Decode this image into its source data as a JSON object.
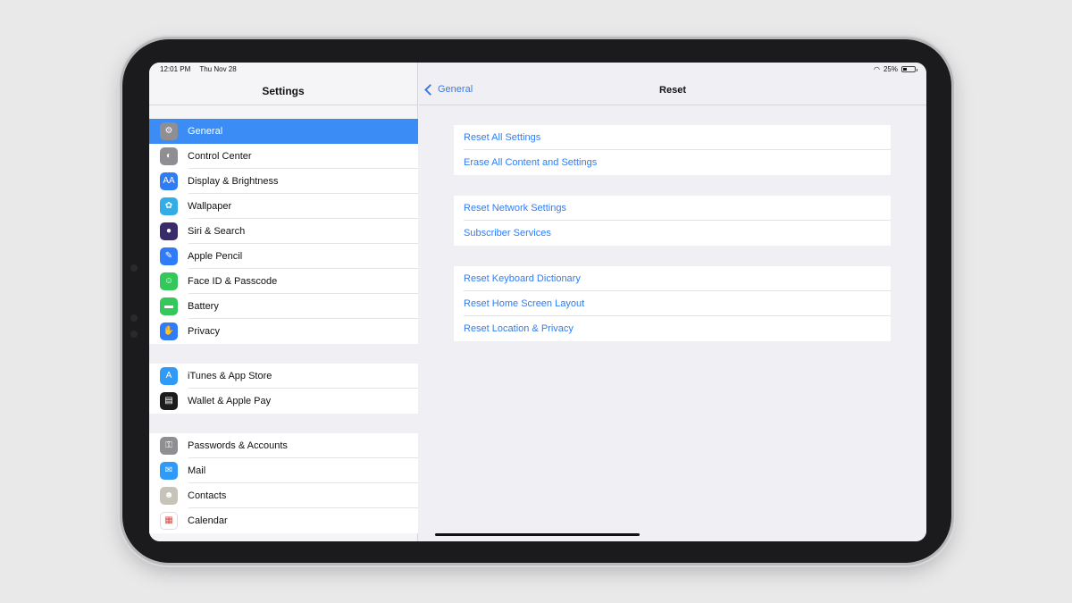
{
  "status": {
    "time": "12:01 PM",
    "date": "Thu Nov 28",
    "battery": "25%"
  },
  "sidebar": {
    "title": "Settings",
    "groups": [
      [
        {
          "label": "General",
          "icon": "gear-icon",
          "color": "#8e8e93",
          "glyph": "⚙",
          "selected": true
        },
        {
          "label": "Control Center",
          "icon": "toggles-icon",
          "color": "#8e8e93",
          "glyph": "◐"
        },
        {
          "label": "Display & Brightness",
          "icon": "text-size-icon",
          "color": "#2f7cf6",
          "glyph": "AA"
        },
        {
          "label": "Wallpaper",
          "icon": "flower-icon",
          "color": "#32ade6",
          "glyph": "✿"
        },
        {
          "label": "Siri & Search",
          "icon": "siri-icon",
          "color": "#3a2c68",
          "glyph": "●"
        },
        {
          "label": "Apple Pencil",
          "icon": "pencil-icon",
          "color": "#2f7cf6",
          "glyph": "✎"
        },
        {
          "label": "Face ID & Passcode",
          "icon": "face-id-icon",
          "color": "#34c759",
          "glyph": "☺"
        },
        {
          "label": "Battery",
          "icon": "battery-icon",
          "color": "#34c759",
          "glyph": "▬"
        },
        {
          "label": "Privacy",
          "icon": "hand-icon",
          "color": "#2f7cf6",
          "glyph": "✋"
        }
      ],
      [
        {
          "label": "iTunes & App Store",
          "icon": "app-store-icon",
          "color": "#2f9bf6",
          "glyph": "A"
        },
        {
          "label": "Wallet & Apple Pay",
          "icon": "wallet-icon",
          "color": "#1c1c1e",
          "glyph": "▤"
        }
      ],
      [
        {
          "label": "Passwords & Accounts",
          "icon": "key-icon",
          "color": "#8e8e93",
          "glyph": "⚿"
        },
        {
          "label": "Mail",
          "icon": "mail-icon",
          "color": "#2f9bf6",
          "glyph": "✉"
        },
        {
          "label": "Contacts",
          "icon": "contacts-icon",
          "color": "#c7c3b8",
          "glyph": "☻"
        },
        {
          "label": "Calendar",
          "icon": "calendar-icon",
          "color": "#ffffff",
          "glyph": "▦"
        }
      ]
    ]
  },
  "detail": {
    "back_label": "General",
    "title": "Reset",
    "groups": [
      [
        "Reset All Settings",
        "Erase All Content and Settings"
      ],
      [
        "Reset Network Settings",
        "Subscriber Services"
      ],
      [
        "Reset Keyboard Dictionary",
        "Reset Home Screen Layout",
        "Reset Location & Privacy"
      ]
    ]
  }
}
